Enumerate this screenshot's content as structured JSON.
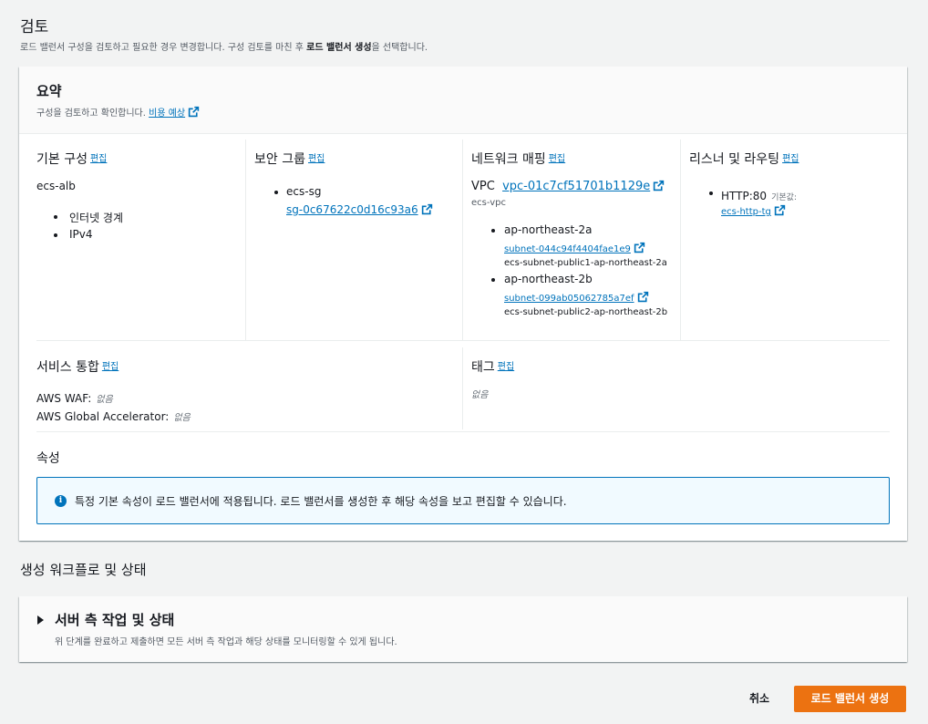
{
  "page": {
    "title": "검토",
    "subtitle_pre": "로드 밸런서 구성을 검토하고 필요한 경우 변경합니다. 구성 검토를 마친 후 ",
    "subtitle_bold": "로드 밸런서 생성",
    "subtitle_post": "을 선택합니다."
  },
  "summary": {
    "title": "요약",
    "desc": "구성을 검토하고 확인합니다.",
    "cost_link": "비용 예상",
    "edit_label": "편집",
    "basic": {
      "title": "기본 구성",
      "name": "ecs-alb",
      "items": [
        "인터넷 경계",
        "IPv4"
      ]
    },
    "security": {
      "title": "보안 그룹",
      "sg_name": "ecs-sg",
      "sg_id": "sg-0c67622c0d16c93a6"
    },
    "network": {
      "title": "네트워크 매핑",
      "vpc_label": "VPC",
      "vpc_id": "vpc-01c7cf51701b1129e",
      "vpc_name": "ecs-vpc",
      "subnets": [
        {
          "az": "ap-northeast-2a",
          "id": "subnet-044c94f4404fae1e9",
          "name": "ecs-subnet-public1-ap-northeast-2a"
        },
        {
          "az": "ap-northeast-2b",
          "id": "subnet-099ab05062785a7ef",
          "name": "ecs-subnet-public2-ap-northeast-2b"
        }
      ]
    },
    "listener": {
      "title": "리스너 및 라우팅",
      "protocol": "HTTP:80",
      "default_label": "기본값:",
      "target_group": "ecs-http-tg"
    },
    "services": {
      "title": "서비스 통합",
      "waf_label": "AWS WAF:",
      "waf_value": "없음",
      "ga_label": "AWS Global Accelerator:",
      "ga_value": "없음"
    },
    "tags": {
      "title": "태그",
      "value": "없음"
    },
    "attributes": {
      "title": "속성",
      "info": "특정 기본 속성이 로드 밸런서에 적용됩니다. 로드 밸런서를 생성한 후 해당 속성을 보고 편집할 수 있습니다."
    }
  },
  "workflow": {
    "title": "생성 워크플로 및 상태",
    "panel_title": "서버 측 작업 및 상태",
    "panel_desc": "위 단계를 완료하고 제출하면 모든 서버 측 작업과 해당 상태를 모니터링할 수 있게 됩니다."
  },
  "actions": {
    "cancel": "취소",
    "create": "로드 밸런서 생성"
  },
  "colors": {
    "link": "#0073bb",
    "primary_button": "#ec7211",
    "info_border": "#0073bb",
    "info_bg": "#f1faff"
  }
}
